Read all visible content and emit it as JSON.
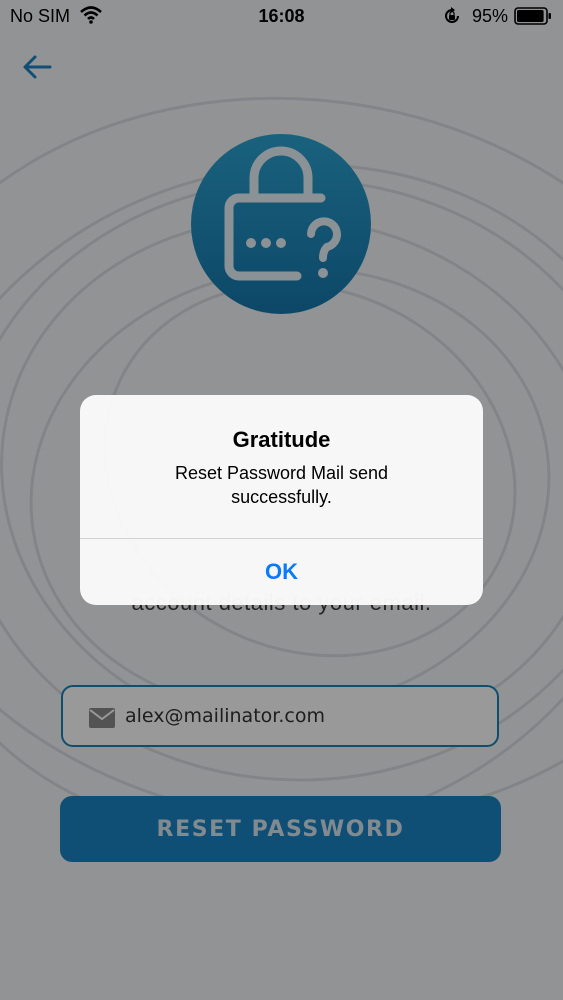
{
  "status_bar": {
    "carrier": "No SIM",
    "time": "16:08",
    "battery_percent": "95%",
    "battery_level": 0.95
  },
  "screen": {
    "subtitle_partial": "account details to your email.",
    "email_value": "alex@mailinator.com",
    "reset_button_label": "RESET PASSWORD"
  },
  "alert": {
    "title": "Gratitude",
    "message": "Reset Password Mail send successfully.",
    "ok_label": "OK"
  },
  "icons": {
    "back": "back-arrow-icon",
    "hero": "lock-question-icon",
    "email": "mail-icon"
  },
  "colors": {
    "accent": "#1a84c3",
    "ios_blue": "#0a7aff",
    "hero_gradient_top": "#2ba3d1",
    "hero_gradient_bottom": "#1677ad"
  }
}
